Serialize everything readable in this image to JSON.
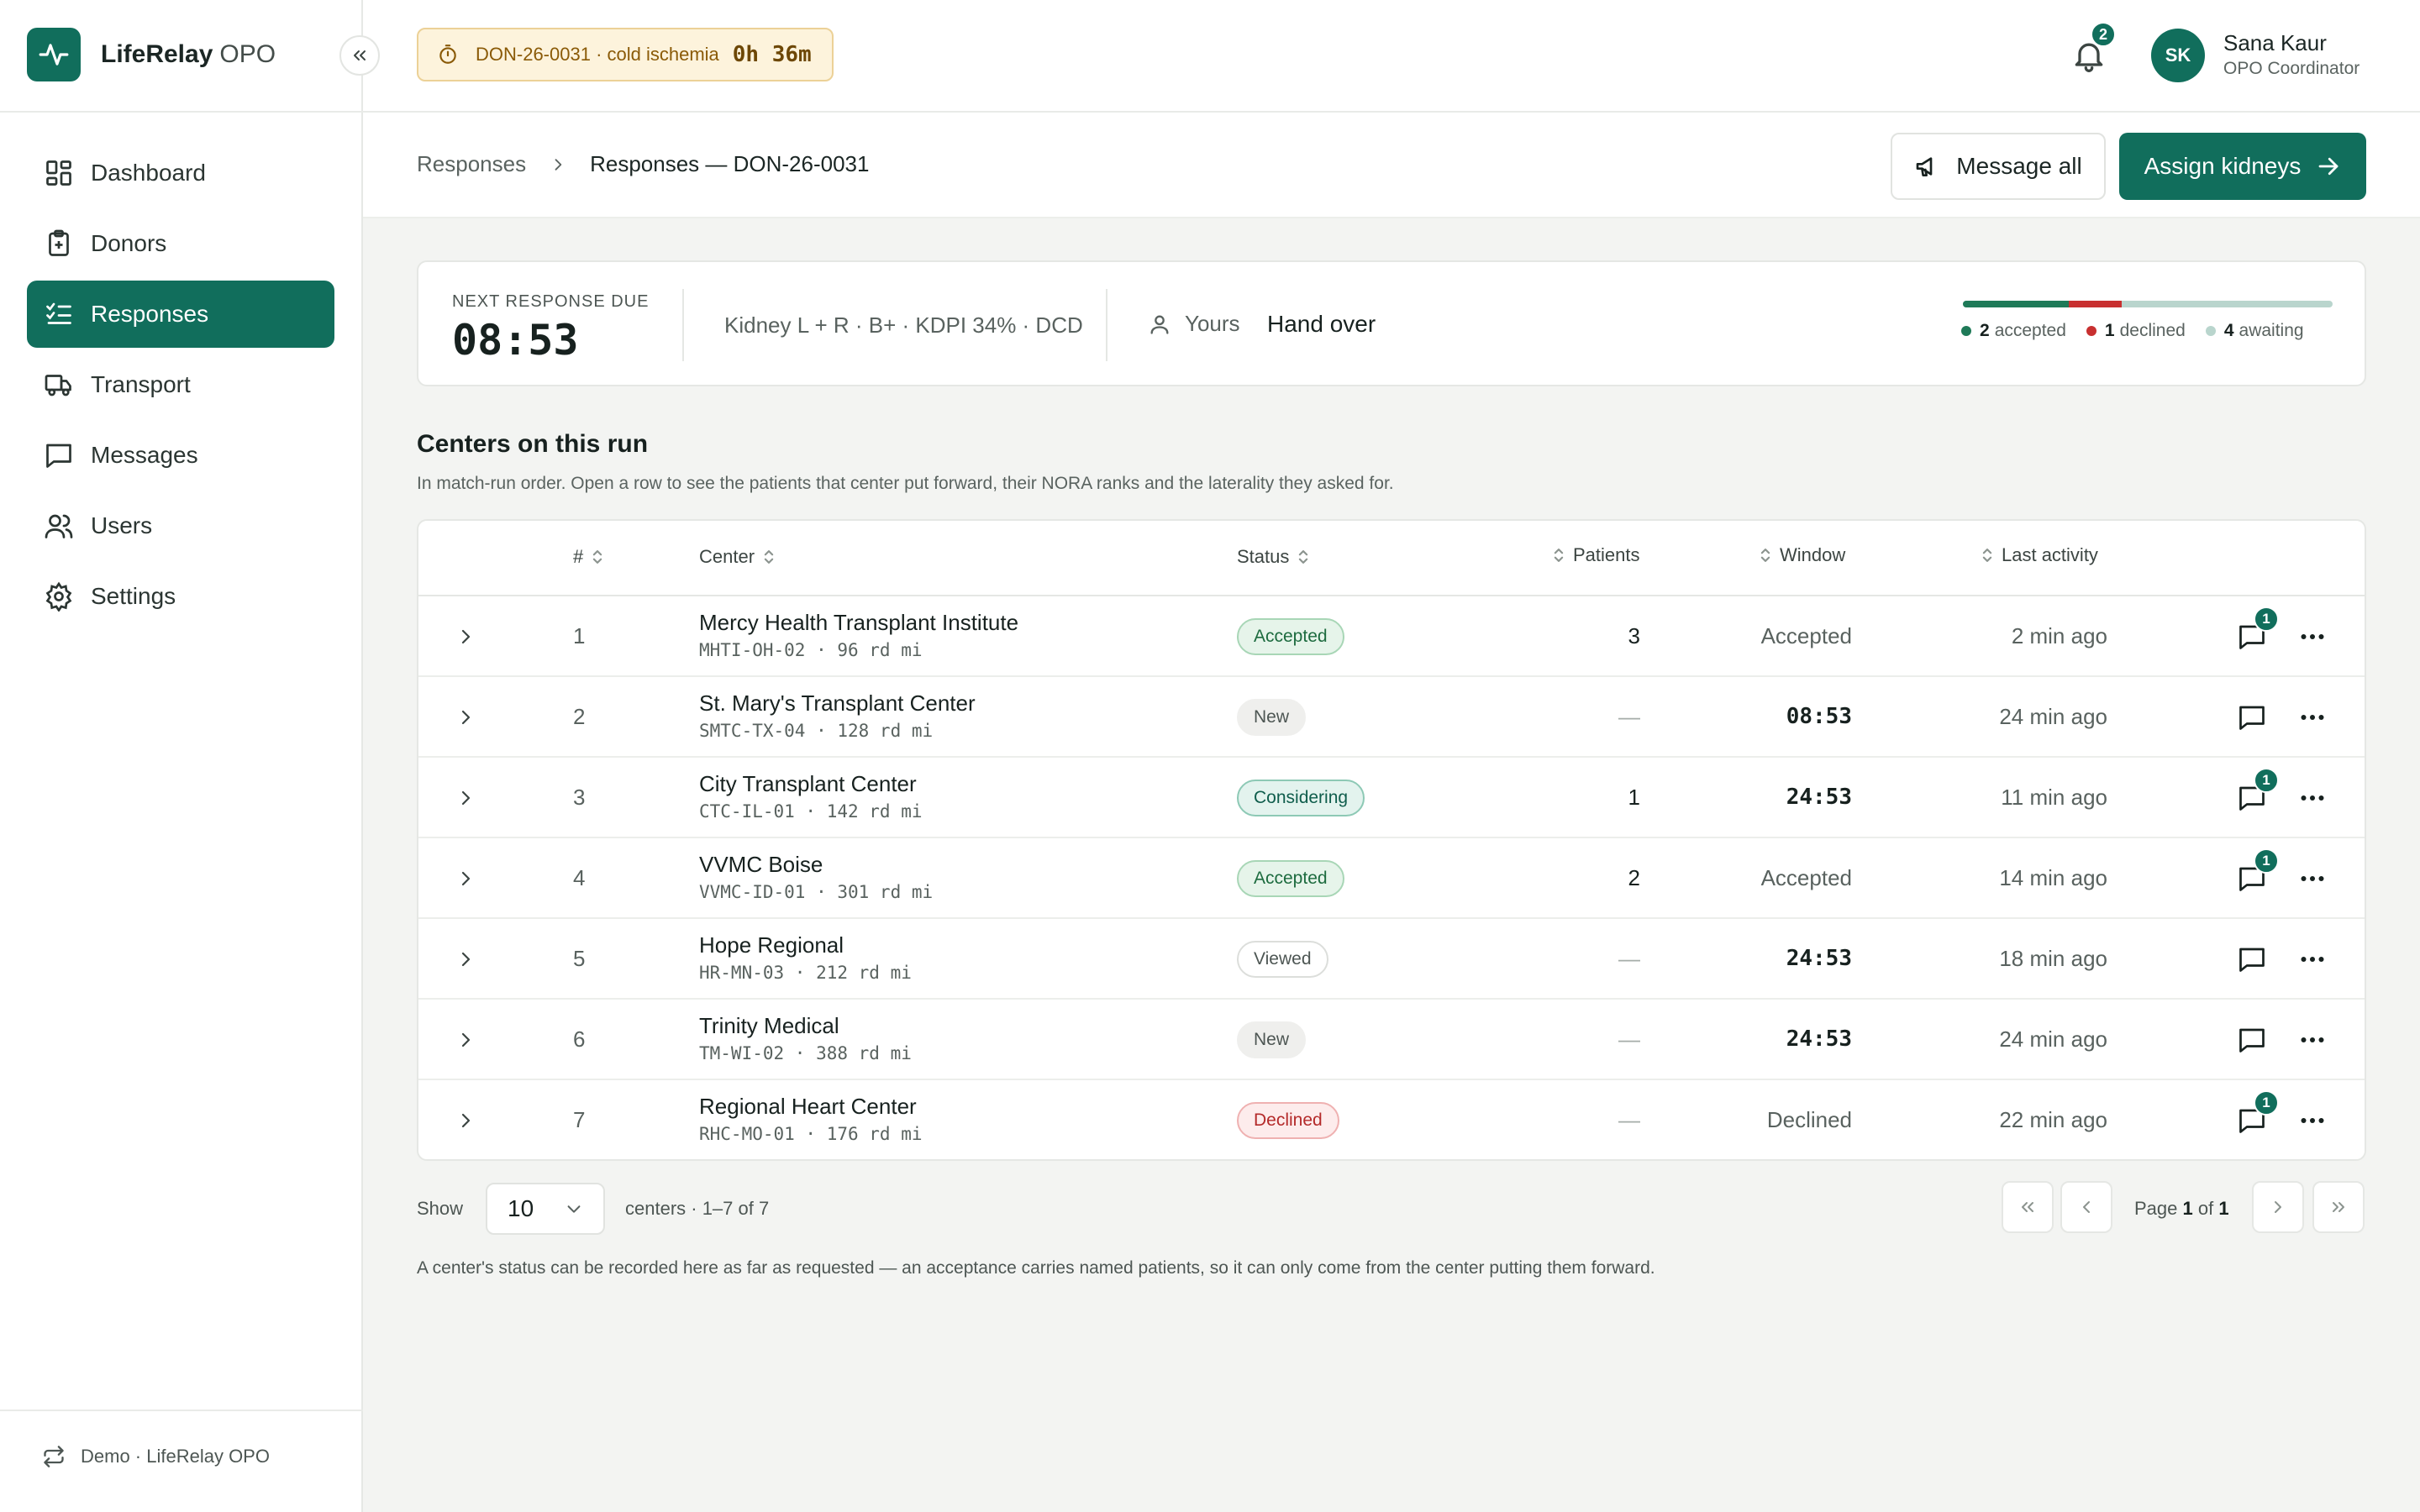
{
  "brand": {
    "name": "LifeRelay",
    "suffix": "OPO"
  },
  "sidebar": {
    "items": [
      {
        "label": "Dashboard",
        "icon": "dashboard-icon"
      },
      {
        "label": "Donors",
        "icon": "clipboard-plus-icon"
      },
      {
        "label": "Responses",
        "icon": "list-check-icon",
        "active": true
      },
      {
        "label": "Transport",
        "icon": "truck-icon"
      },
      {
        "label": "Messages",
        "icon": "message-icon"
      },
      {
        "label": "Users",
        "icon": "users-icon"
      },
      {
        "label": "Settings",
        "icon": "gear-icon"
      }
    ],
    "footer": "Demo · LifeRelay OPO"
  },
  "topbar": {
    "ischemia_label": "DON-26-0031 · cold ischemia",
    "ischemia_time": "0h 36m",
    "notifications": "2",
    "user": {
      "initials": "SK",
      "name": "Sana Kaur",
      "role": "OPO Coordinator"
    }
  },
  "header": {
    "breadcrumb_root": "Responses",
    "breadcrumb_current": "Responses — DON-26-0031",
    "message_all": "Message all",
    "assign": "Assign kidneys"
  },
  "summary": {
    "label": "NEXT RESPONSE DUE",
    "countdown": "08:53",
    "organ": "Kidney L + R · B+ · KDPI 34% · DCD",
    "owner": "Yours",
    "handover": "Hand over",
    "accepted_count": "2",
    "accepted_label": "accepted",
    "declined_count": "1",
    "declined_label": "declined",
    "awaiting_count": "4",
    "awaiting_label": "awaiting",
    "colors": {
      "accepted": "#1f7a58",
      "declined": "#c83030",
      "awaiting": "#b9d5cd"
    }
  },
  "section": {
    "title": "Centers on this run",
    "subtitle": "In match-run order. Open a row to see the patients that center put forward, their NORA ranks and the laterality they asked for."
  },
  "table": {
    "columns": {
      "num": "#",
      "center": "Center",
      "status": "Status",
      "patients": "Patients",
      "window": "Window",
      "activity": "Last activity"
    },
    "rows": [
      {
        "num": "1",
        "name": "Mercy Health Transplant Institute",
        "code": "MHTI-OH-02 · 96 rd mi",
        "status": "Accepted",
        "status_class": "accepted",
        "patients": "3",
        "window": "Accepted",
        "window_timer": false,
        "activity": "2 min ago",
        "messages": "1"
      },
      {
        "num": "2",
        "name": "St. Mary's Transplant Center",
        "code": "SMTC-TX-04 · 128 rd mi",
        "status": "New",
        "status_class": "new",
        "patients": "—",
        "window": "08:53",
        "window_timer": true,
        "activity": "24 min ago",
        "messages": ""
      },
      {
        "num": "3",
        "name": "City Transplant Center",
        "code": "CTC-IL-01 · 142 rd mi",
        "status": "Considering",
        "status_class": "considering",
        "patients": "1",
        "window": "24:53",
        "window_timer": true,
        "activity": "11 min ago",
        "messages": "1"
      },
      {
        "num": "4",
        "name": "VVMC Boise",
        "code": "VVMC-ID-01 · 301 rd mi",
        "status": "Accepted",
        "status_class": "accepted",
        "patients": "2",
        "window": "Accepted",
        "window_timer": false,
        "activity": "14 min ago",
        "messages": "1"
      },
      {
        "num": "5",
        "name": "Hope Regional",
        "code": "HR-MN-03 · 212 rd mi",
        "status": "Viewed",
        "status_class": "viewed",
        "patients": "—",
        "window": "24:53",
        "window_timer": true,
        "activity": "18 min ago",
        "messages": ""
      },
      {
        "num": "6",
        "name": "Trinity Medical",
        "code": "TM-WI-02 · 388 rd mi",
        "status": "New",
        "status_class": "new",
        "patients": "—",
        "window": "24:53",
        "window_timer": true,
        "activity": "24 min ago",
        "messages": ""
      },
      {
        "num": "7",
        "name": "Regional Heart Center",
        "code": "RHC-MO-01 · 176 rd mi",
        "status": "Declined",
        "status_class": "declined",
        "patients": "—",
        "window": "Declined",
        "window_timer": false,
        "activity": "22 min ago",
        "messages": "1"
      }
    ]
  },
  "pagination": {
    "show_label": "Show",
    "page_size": "10",
    "count_label": "centers · 1–7 of 7",
    "page_prefix": "Page",
    "page_current": "1",
    "page_of": "of",
    "page_total": "1"
  },
  "footnote": "A center's status can be recorded here as far as requested — an acceptance carries named patients, so it can only come from the center putting them forward."
}
